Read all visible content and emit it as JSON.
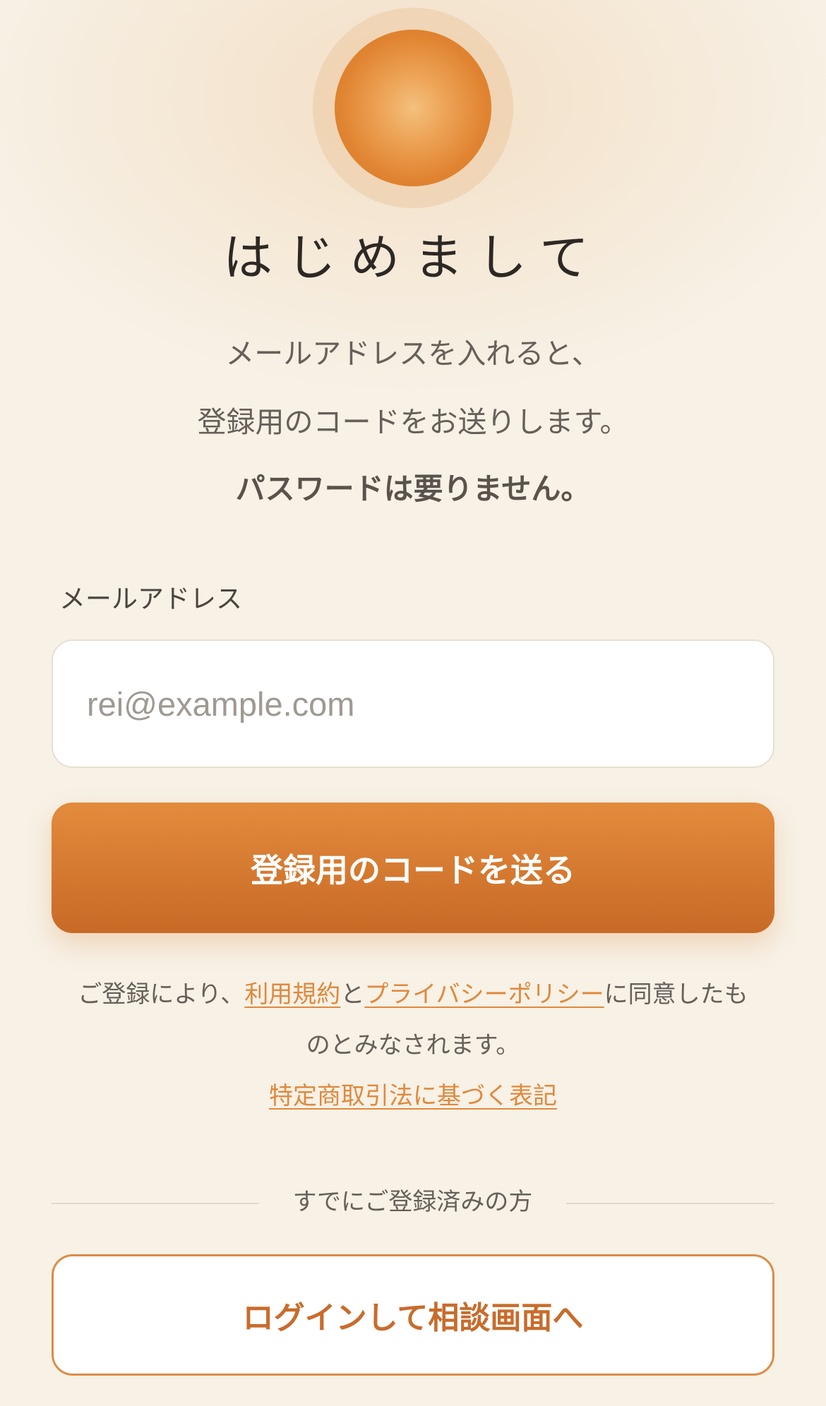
{
  "header": {
    "title": "はじめまして",
    "description_line1": "メールアドレスを入れると、",
    "description_line2": "登録用のコードをお送りします。",
    "description_line3": "パスワードは要りません。"
  },
  "form": {
    "email_label": "メールアドレス",
    "email_placeholder": "rei@example.com",
    "email_value": "",
    "send_button": "登録用のコードを送る"
  },
  "terms": {
    "prefix": "ご登録により、",
    "terms_link": "利用規約",
    "and": "と",
    "privacy_link": "プライバシーポリシー",
    "suffix_line1": "に同意したも",
    "suffix_line2": "のとみなされます。",
    "legal_link": "特定商取引法に基づく表記"
  },
  "existing": {
    "divider_text": "すでにご登録済みの方",
    "login_button": "ログインして相談画面へ"
  },
  "colors": {
    "background": "#f7f1e6",
    "accent": "#e08431",
    "link": "#e0893c"
  },
  "icons": {
    "hero": "orange-orb-icon"
  }
}
